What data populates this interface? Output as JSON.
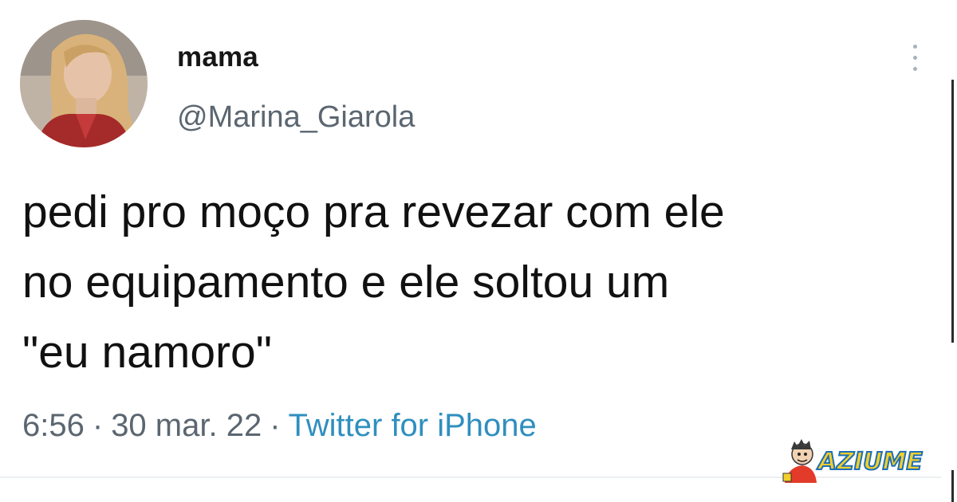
{
  "tweet": {
    "author": {
      "display_name": "mama",
      "handle": "@Marina_Giarola"
    },
    "text_lines": [
      "pedi pro moço pra revezar com ele",
      "no equipamento e ele soltou um",
      "\"eu namoro\""
    ],
    "meta": {
      "time": "6:56",
      "separator": "·",
      "date": "30 mar. 22",
      "source": "Twitter for iPhone"
    },
    "more_icon": "more-vertical-icon"
  },
  "watermark": {
    "text": "AZIUME",
    "colors": {
      "fill": "#f2cf2a",
      "outline": "#1d6fb8"
    }
  },
  "colors": {
    "text": "#111111",
    "secondary": "#5b6670",
    "link": "#2f8fbf",
    "background": "#ffffff"
  }
}
